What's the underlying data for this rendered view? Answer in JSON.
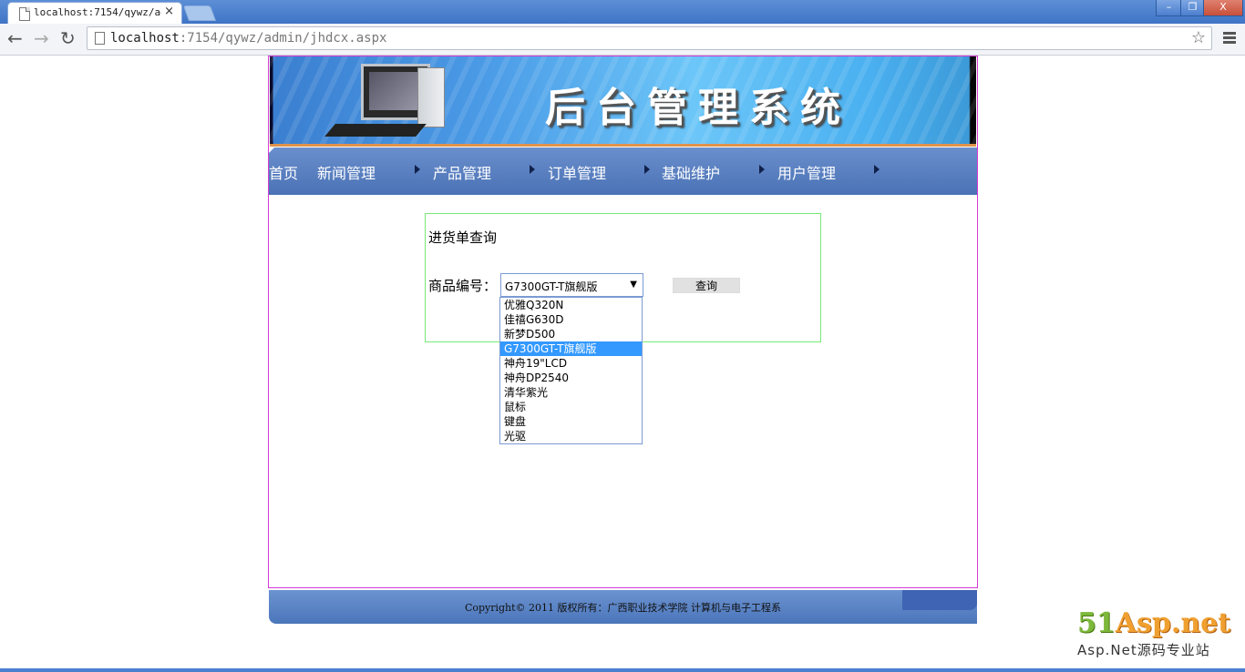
{
  "browser": {
    "tab_title": "localhost:7154/qywz/adm",
    "tab_close": "×",
    "url_host": "localhost",
    "url_rest": ":7154/qywz/admin/jhdcx.aspx",
    "back": "←",
    "forward": "→",
    "reload": "↻",
    "star": "☆",
    "win_min": "–",
    "win_max": "❐",
    "win_close": "X"
  },
  "banner": {
    "title": "后台管理系统"
  },
  "nav": {
    "items": [
      "首页",
      "新闻管理",
      "产品管理",
      "订单管理",
      "基础维护",
      "用户管理"
    ]
  },
  "query": {
    "title": "进货单查询",
    "label": "商品编号：",
    "selected": "G7300GT-T旗舰版",
    "dropdown_arrow": "▼",
    "options": [
      "优雅Q320N",
      "佳禧G630D",
      "新梦D500",
      "G7300GT-T旗舰版",
      "神舟19\"LCD",
      "神舟DP2540",
      "清华紫光",
      "鼠标",
      "键盘",
      "光驱"
    ],
    "selected_index": 3,
    "button": "查询"
  },
  "footer": {
    "copyright": "Copyright© 2011 版权所有：广西职业技术学院 计算机与电子工程系"
  },
  "watermark": {
    "brand_num": "51",
    "brand_rest": "Asp.net",
    "sub": "Asp.Net源码专业站"
  },
  "colors": {
    "frame_border": "#d63ad6",
    "nav_bg": "#5a80c2",
    "query_border": "#77e877",
    "selected_option": "#3399ff"
  }
}
